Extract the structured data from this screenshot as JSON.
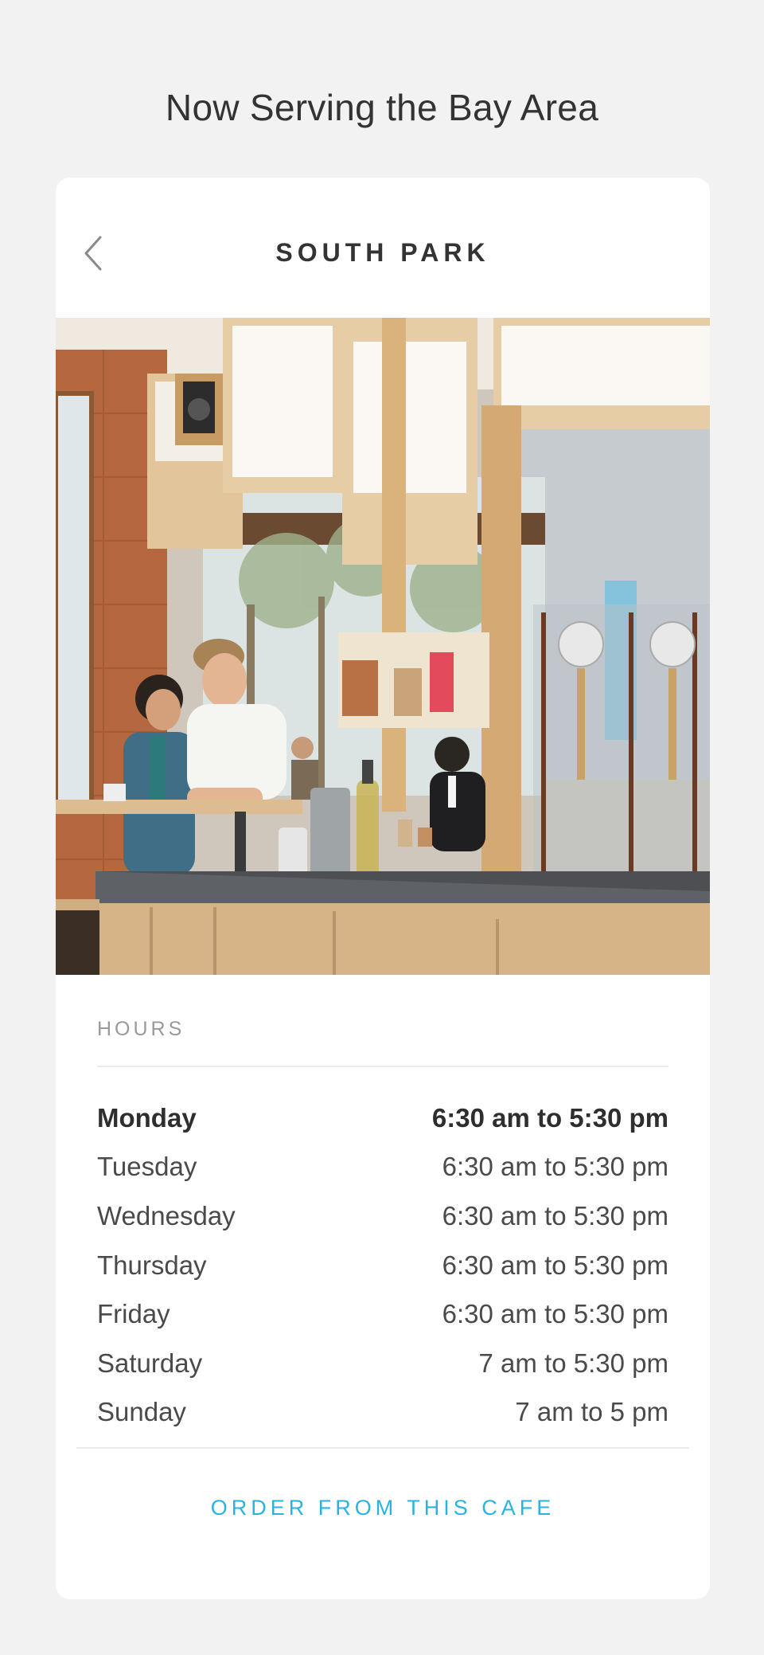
{
  "page": {
    "heading": "Now Serving the Bay Area"
  },
  "card": {
    "title": "SOUTH PARK",
    "back_icon": "chevron-left-icon",
    "photo_subject": "cafe-interior-photo"
  },
  "hours": {
    "label": "HOURS",
    "rows": [
      {
        "day": "Monday",
        "time": "6:30 am to 5:30 pm",
        "today": true
      },
      {
        "day": "Tuesday",
        "time": "6:30 am to 5:30 pm",
        "today": false
      },
      {
        "day": "Wednesday",
        "time": "6:30 am to 5:30 pm",
        "today": false
      },
      {
        "day": "Thursday",
        "time": "6:30 am to 5:30 pm",
        "today": false
      },
      {
        "day": "Friday",
        "time": "6:30 am to 5:30 pm",
        "today": false
      },
      {
        "day": "Saturday",
        "time": "7 am to 5:30 pm",
        "today": false
      },
      {
        "day": "Sunday",
        "time": "7 am to 5 pm",
        "today": false
      }
    ]
  },
  "order": {
    "label": "ORDER FROM THIS CAFE"
  },
  "colors": {
    "accent": "#2bb3e0",
    "background": "#f2f2f2",
    "card": "#ffffff",
    "text": "#333333",
    "muted": "#9a9a9a"
  }
}
